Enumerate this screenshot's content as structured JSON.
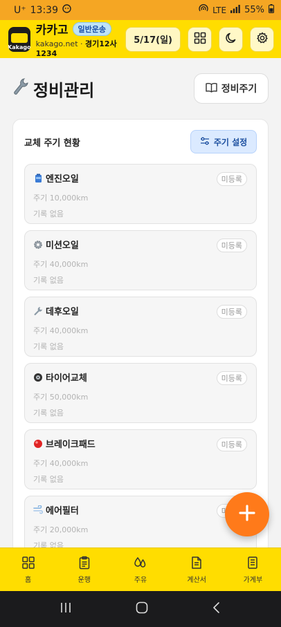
{
  "status_bar": {
    "carrier": "U⁺",
    "time": "13:39",
    "network": "LTE",
    "battery": "55%"
  },
  "header": {
    "app_name": "카카고",
    "badge": "일반운송",
    "site": "kakago.net",
    "separator": "·",
    "plate": "경기12사1234",
    "logo_text": "Kakago",
    "date_label": "5/17(일)",
    "icons": [
      "grid-icon",
      "moon-icon",
      "gear-icon"
    ]
  },
  "page": {
    "title": "정비관리",
    "title_icon": "wrench-icon",
    "cycle_button": "정비주기"
  },
  "panel": {
    "title": "교체 주기 현황",
    "settings_button": "주기 설정",
    "items": [
      {
        "emoji": "oil-can-icon",
        "name": "엔진오일",
        "cycle": "주기 10,000km",
        "record": "기록 없음",
        "status": "미등록"
      },
      {
        "emoji": "gear-icon",
        "name": "미션오일",
        "cycle": "주기 40,000km",
        "record": "기록 없음",
        "status": "미등록"
      },
      {
        "emoji": "wrench-icon",
        "name": "데후오일",
        "cycle": "주기 40,000km",
        "record": "기록 없음",
        "status": "미등록"
      },
      {
        "emoji": "tire-icon",
        "name": "타이어교체",
        "cycle": "주기 50,000km",
        "record": "기록 없음",
        "status": "미등록"
      },
      {
        "emoji": "red-circle-icon",
        "name": "브레이크패드",
        "cycle": "주기 40,000km",
        "record": "기록 없음",
        "status": "미등록"
      },
      {
        "emoji": "wind-icon",
        "name": "에어필터",
        "cycle": "주기 20,000km",
        "record": "기록 없음",
        "status": "미등록"
      }
    ]
  },
  "fab": {
    "icon": "plus-icon"
  },
  "bottom_nav": [
    {
      "label": "홈",
      "icon": "grid-icon"
    },
    {
      "label": "운행",
      "icon": "clipboard-icon"
    },
    {
      "label": "주유",
      "icon": "droplets-icon"
    },
    {
      "label": "계산서",
      "icon": "document-icon"
    },
    {
      "label": "가계부",
      "icon": "ledger-icon"
    }
  ],
  "colors": {
    "brand_yellow": "#ffdd00",
    "status_bar": "#f5a623",
    "accent_orange": "#ff7a1a",
    "accent_blue": "#1c4f9f"
  }
}
